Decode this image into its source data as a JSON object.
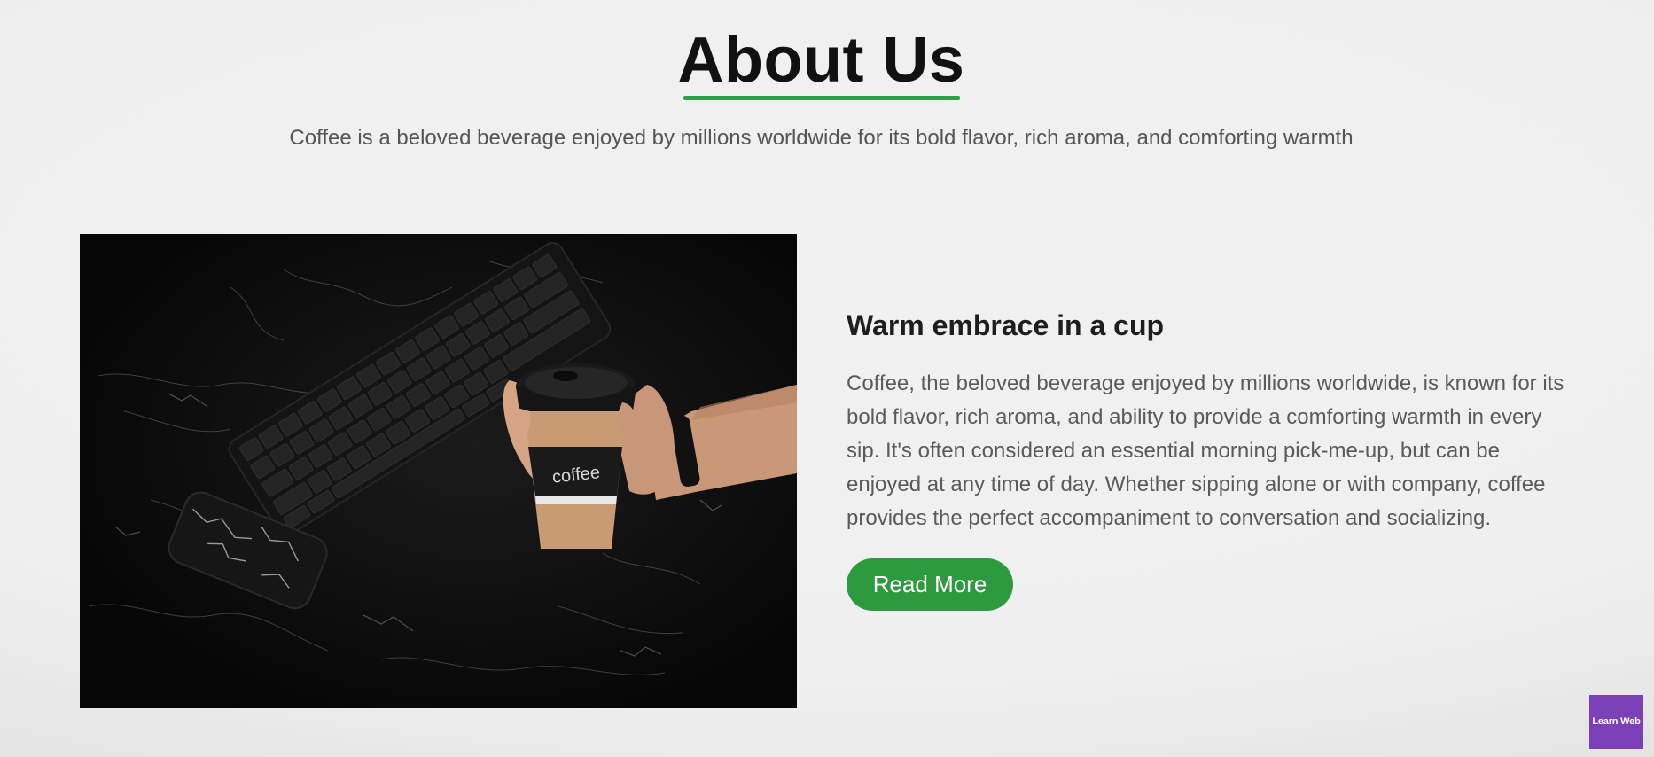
{
  "header": {
    "title": "About Us",
    "subtitle": "Coffee is a beloved beverage enjoyed by millions worldwide for its bold flavor, rich aroma, and comforting warmth"
  },
  "card": {
    "image": {
      "cup_label": "coffee"
    },
    "heading": "Warm embrace in a cup",
    "body": "Coffee, the beloved beverage enjoyed by millions worldwide, is known for its bold flavor, rich aroma, and ability to provide a comforting warmth in every sip. It's often considered an essential morning pick-me-up, but can be enjoyed at any time of day. Whether sipping alone or with company, coffee provides the perfect accompaniment to conversation and socializing.",
    "button_label": "Read More"
  },
  "watermark": {
    "label": "Learn Web"
  },
  "colors": {
    "accent": "#31a043",
    "button_bg": "#2e9a40",
    "watermark_bg": "#7b3fb8",
    "background": "#efefef"
  }
}
